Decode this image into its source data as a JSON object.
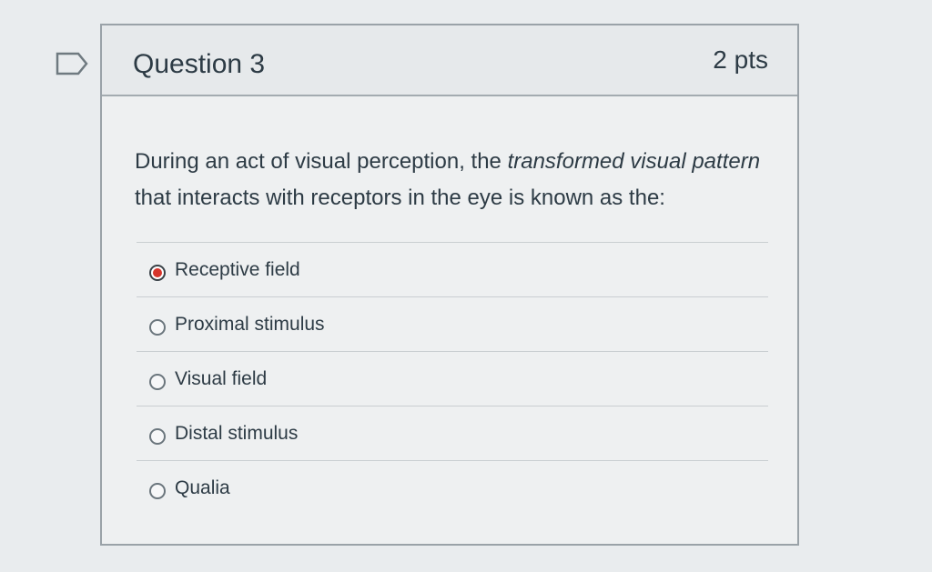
{
  "question": {
    "title": "Question 3",
    "points": "2 pts",
    "text_part1": "During an act of visual perception, the ",
    "text_italic1": "transformed visual pattern",
    "text_part2": " that interacts with receptors in the eye is known as the:",
    "answers": [
      {
        "label": "Receptive field",
        "selected": true
      },
      {
        "label": "Proximal stimulus",
        "selected": false
      },
      {
        "label": "Visual field",
        "selected": false
      },
      {
        "label": "Distal stimulus",
        "selected": false
      },
      {
        "label": "Qualia",
        "selected": false
      }
    ]
  },
  "icons": {
    "bookmark": "bookmark-icon"
  },
  "colors": {
    "selected_radio": "#d6342b",
    "text": "#2d3b45"
  }
}
